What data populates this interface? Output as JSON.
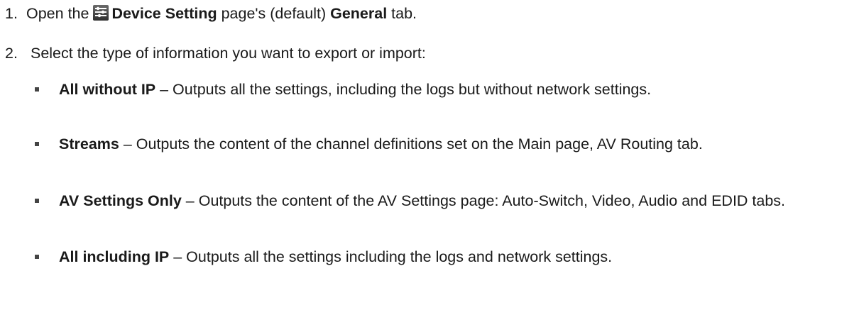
{
  "steps": [
    {
      "number": "1.",
      "before": "Open the ",
      "icon": "device-setting-icon",
      "bold1": "Device Setting",
      "middle": " page's (default) ",
      "bold2": "General",
      "after": " tab."
    },
    {
      "number": "2.",
      "text": "Select the type of information you want to export or import:"
    }
  ],
  "options": [
    {
      "term": "All without IP",
      "desc": " – Outputs all the settings, including the logs but without network settings."
    },
    {
      "term": "Streams",
      "desc": " – Outputs the content of the channel definitions set on the Main page, AV Routing tab."
    },
    {
      "term": "AV Settings Only",
      "desc": " – Outputs the content of the AV Settings page: Auto-Switch, Video, Audio and EDID tabs."
    },
    {
      "term": "All including IP",
      "desc": " – Outputs all the settings including the logs and network settings."
    }
  ]
}
